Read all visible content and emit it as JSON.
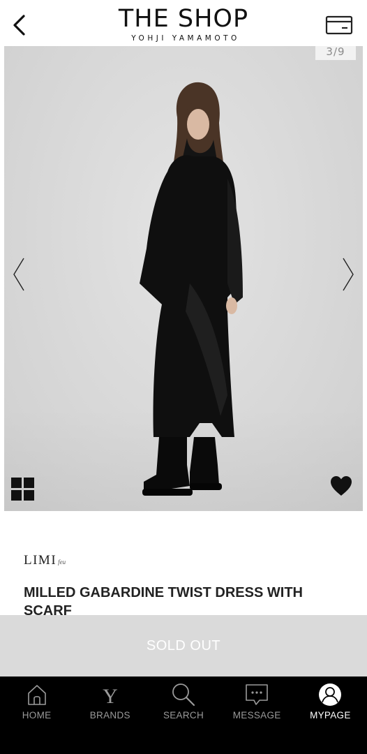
{
  "header": {
    "title": "THE SHOP",
    "subtitle": "YOHJI YAMAMOTO"
  },
  "icons": {
    "back": "chevron-left-icon",
    "card": "credit-card-icon",
    "prev": "chevron-left-thin-icon",
    "next": "chevron-right-thin-icon",
    "grid": "grid-icon",
    "favorite": "heart-icon"
  },
  "gallery": {
    "counter": "3/9"
  },
  "product": {
    "brand": "LIMI",
    "brand_suffix": "feu",
    "name": "MILLED GABARDINE TWIST DRESS WITH SCARF"
  },
  "purchase": {
    "button_label": "SOLD OUT"
  },
  "bottom_nav": {
    "items": [
      {
        "label": "HOME",
        "icon": "home-icon",
        "active": false
      },
      {
        "label": "BRANDS",
        "icon": "y-brand-icon",
        "active": false
      },
      {
        "label": "SEARCH",
        "icon": "search-icon",
        "active": false
      },
      {
        "label": "MESSAGE",
        "icon": "message-icon",
        "active": false
      },
      {
        "label": "MYPAGE",
        "icon": "user-icon",
        "active": true
      }
    ]
  },
  "colors": {
    "nav_bg": "#000000",
    "nav_inactive": "#9a9a9a",
    "nav_active": "#ffffff",
    "soldout_bg": "#dadada"
  }
}
